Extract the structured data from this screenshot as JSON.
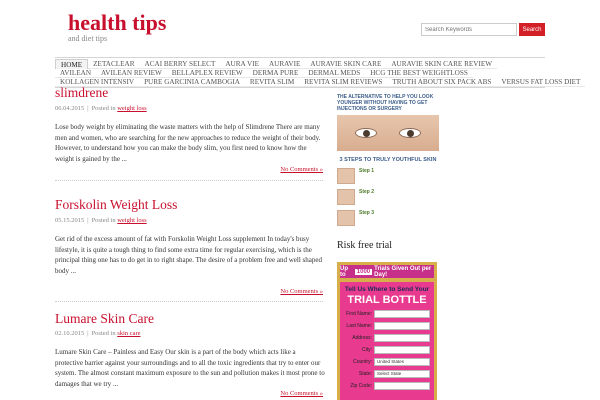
{
  "site": {
    "title": "health tips",
    "description": "and diet tips"
  },
  "search": {
    "placeholder": "Search Keywords",
    "button_label": "Search"
  },
  "nav": {
    "row1": [
      "HOME",
      "ZETACLEAR",
      "ACAI BERRY SELECT",
      "AURA VIE",
      "AURAVIE",
      "AURAVIE SKIN CARE",
      "AURAVIE SKIN CARE REVIEW"
    ],
    "row2": [
      "AVILEAN",
      "AVILEAN REVIEW",
      "BELLAPLEX REVIEW",
      "DERMA PURE",
      "DERMAL MEDS",
      "HCG THE BEST WEIGHTLOSS"
    ],
    "row3": [
      "KOLLAGEN INTENSIV",
      "PURE GARCINIA CAMBOGIA",
      "REVITA SLIM",
      "REVITA SLIM REVIEWS",
      "TRUTH ABOUT SIX PACK ABS",
      "VERSUS FAT LOSS DIET"
    ]
  },
  "posts": [
    {
      "title": "slimdrene",
      "date": "06.04.2015",
      "posted_in": "Posted in",
      "category": "weight loss",
      "excerpt": "Lose body weight by eliminating the waste matters with the help of Slimdrene There are many men and women, who are searching for the new approaches to reduce the weight of their body. However, to understand how you can make the body slim, you first need to know how the weight is gained by the ...",
      "comments": "No Comments »"
    },
    {
      "title": "Forskolin Weight Loss",
      "date": "05.15.2015",
      "posted_in": "Posted in",
      "category": "weight loss",
      "excerpt": "Get rid of the excess amount of fat with Forskolin Weight Loss supplement In today's busy lifestyle, it is quite a tough thing to find some extra time for regular exercising, which is the principal thing one has to do get in to right shape. The desire of a problem free and well shaped body ...",
      "comments": "No Comments »"
    },
    {
      "title": "Lumare Skin Care",
      "date": "02.10.2015",
      "posted_in": "Posted in",
      "category": "skin care",
      "excerpt": "Lumare Skin Care – Painless and Easy Our skin is a part of the body which acts like a protective barrier against your surroundings and to all the toxic ingredients that try to enter our system. The almost constant maximum exposure to the sun and pollution makes it most prone to damages that we try ...",
      "comments": "No Comments »"
    }
  ],
  "sidebar": {
    "ad1": {
      "headline": "THE ALTERNATIVE TO HELP YOU LOOK YOUNGER WITHOUT HAVING TO GET INJECTIONS OR SURGERY",
      "steps_heading": "3 STEPS TO TRULY YOUTHFUL SKIN",
      "steps": [
        {
          "label": "Step 1"
        },
        {
          "label": "Step 2"
        },
        {
          "label": "Step 3"
        }
      ]
    },
    "widget_title": "Risk free trial",
    "ad2": {
      "banner_pre": "Up to",
      "banner_num": "1000",
      "banner_post": "Trials Given Out per Day!",
      "card_title": "Tell Us Where to Send Your",
      "card_big": "TRIAL BOTTLE",
      "fields": [
        {
          "label": "First Name:",
          "value": ""
        },
        {
          "label": "Last Name:",
          "value": ""
        },
        {
          "label": "Address:",
          "value": ""
        },
        {
          "label": "City:",
          "value": ""
        },
        {
          "label": "Country:",
          "value": "United States"
        },
        {
          "label": "State:",
          "value": "Select State"
        },
        {
          "label": "Zip Code:",
          "value": ""
        }
      ]
    }
  }
}
